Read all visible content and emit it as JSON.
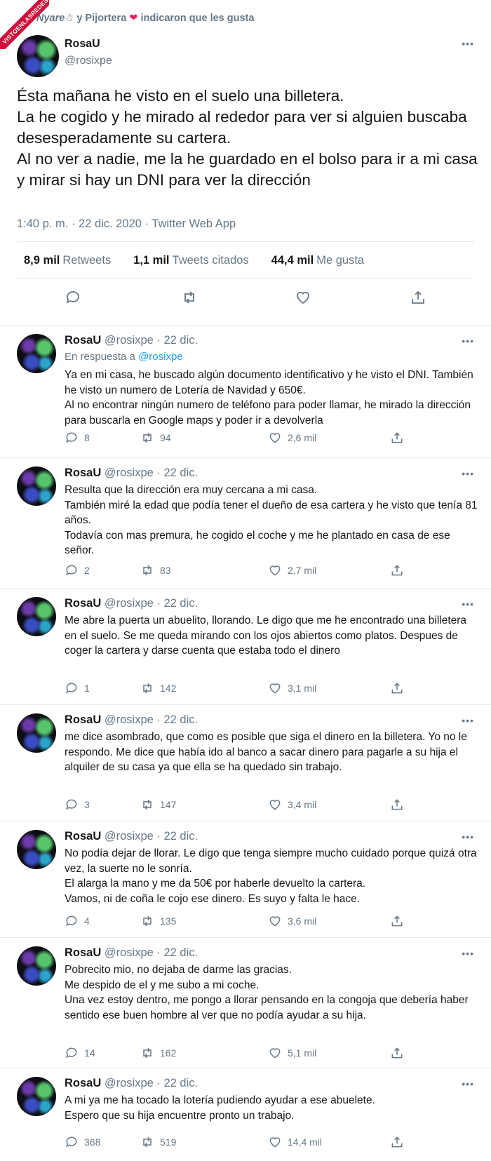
{
  "watermark": {
    "text": "VISTOENLASREDES"
  },
  "liked_bar": {
    "user1": "Nyare",
    "emoji": "☃",
    "middle": " y Pijortera ",
    "heart": "❤",
    "suffix": "indicaron que les gusta"
  },
  "main_tweet": {
    "name": "RosaU",
    "handle": "@rosixpe",
    "more": "•••",
    "text": "Ésta mañana he visto en el suelo una billetera.\nLa he cogido y he mirado al rededor para ver si alguien buscaba desesperadamente su cartera.\nAl no ver a nadie, me la he guardado en el bolso para ir a mi casa y mirar si hay un DNI para ver la dirección",
    "meta": "1:40 p. m. · 22 dic. 2020 · Twitter Web App",
    "stats": [
      {
        "value": "8,9 mil",
        "label": "Retweets"
      },
      {
        "value": "1,1 mil",
        "label": "Tweets citados"
      },
      {
        "value": "44,4 mil",
        "label": "Me gusta"
      }
    ],
    "icons": [
      "reply-icon",
      "retweet-icon",
      "like-icon",
      "share-icon"
    ]
  },
  "replies": [
    {
      "name": "RosaU",
      "handle": "@rosixpe",
      "date": "· 22 dic.",
      "in_reply_prefix": "En respuesta a ",
      "in_reply_to": "@rosixpe",
      "text": "Ya en mi casa, he buscado algún documento identificativo y he visto el DNI. También he visto un numero de Lotería de Navidad y 650€.\nAl no encontrar ningún numero de teléfono para poder llamar, he mirado la dirección para buscarla en Google maps y poder ir a devolverla",
      "replies": "8",
      "retweets": "94",
      "likes": "2,6 mil"
    },
    {
      "name": "RosaU",
      "handle": "@rosixpe",
      "date": "· 22 dic.",
      "text": "Resulta que la dirección era muy cercana a mi casa.\nTambién miré la edad que podía tener el dueño de esa cartera y he visto que tenía 81 años.\nTodavía con mas premura, he cogido el coche y me he plantado en casa de ese señor.",
      "replies": "2",
      "retweets": "83",
      "likes": "2,7 mil"
    },
    {
      "name": "RosaU",
      "handle": "@rosixpe",
      "date": "· 22 dic.",
      "text": "Me abre la puerta un abuelito, llorando. Le digo que me he encontrado una billetera en el suelo. Se me queda mirando con los ojos abiertos como platos. Despues de coger la cartera y darse cuenta que estaba todo el dinero",
      "replies": "1",
      "retweets": "142",
      "likes": "3,1 mil"
    },
    {
      "name": "RosaU",
      "handle": "@rosixpe",
      "date": "· 22 dic.",
      "text": "me dice asombrado, que como es posible que siga el dinero en la billetera. Yo no le respondo. Me dice que había ido al banco a sacar dinero para pagarle a su hija el alquiler de su casa ya que ella se ha quedado sin trabajo.",
      "replies": "3",
      "retweets": "147",
      "likes": "3,4 mil"
    },
    {
      "name": "RosaU",
      "handle": "@rosixpe",
      "date": "· 22 dic.",
      "text": "No podía dejar de llorar. Le digo que tenga siempre mucho cuidado porque quizá otra vez, la suerte no le sonría.\nEl alarga la mano y me da 50€ por haberle devuelto la cartera.\nVamos, ni de coña le cojo ese dinero. Es suyo y falta le hace.",
      "replies": "4",
      "retweets": "135",
      "likes": "3,6 mil"
    },
    {
      "name": "RosaU",
      "handle": "@rosixpe",
      "date": "· 22 dic.",
      "text": "Pobrecito mio, no dejaba de darme las gracias.\nMe despido de el y me subo a mi coche.\nUna vez estoy dentro, me pongo a llorar pensando en la congoja que debería haber sentido ese buen hombre al ver que no podía ayudar a su hija.",
      "replies": "14",
      "retweets": "162",
      "likes": "5,1 mil"
    },
    {
      "name": "RosaU",
      "handle": "@rosixpe",
      "date": "· 22 dic.",
      "text": "A mi ya me ha tocado la lotería pudiendo ayudar a ese abuelete.\nEspero que su hija encuentre pronto un trabajo.",
      "replies": "368",
      "retweets": "519",
      "likes": "14,4 mil"
    }
  ]
}
